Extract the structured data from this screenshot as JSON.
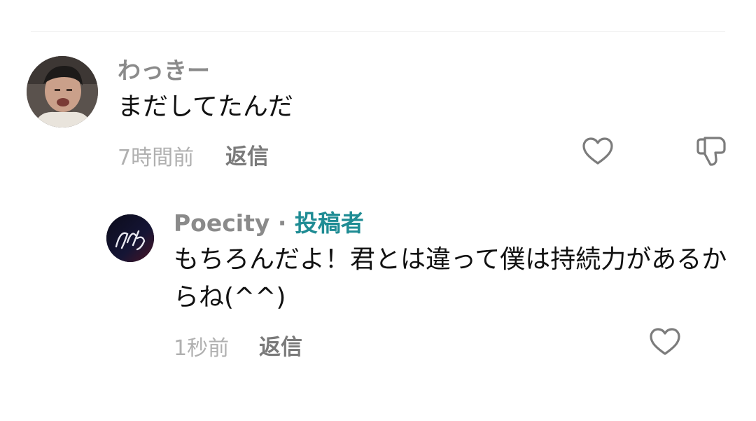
{
  "comments": [
    {
      "username": "わっきー",
      "text": "まだしてたんだ",
      "time": "7時間前",
      "reply_label": "返信"
    },
    {
      "username": "Poecity",
      "separator": " · ",
      "badge": "投稿者",
      "text": "もちろんだよ！君とは違って僕は持続力があるからね(^^)",
      "time": "1秒前",
      "reply_label": "返信"
    }
  ],
  "icons": {
    "like": "heart-outline-icon",
    "dislike": "thumbs-down-outline-icon"
  },
  "colors": {
    "username": "#8a8a8a",
    "author_badge": "#1f8c94",
    "time": "#b0b0b0",
    "reply": "#7a7a7a",
    "icon_stroke": "#7c7c7c"
  }
}
